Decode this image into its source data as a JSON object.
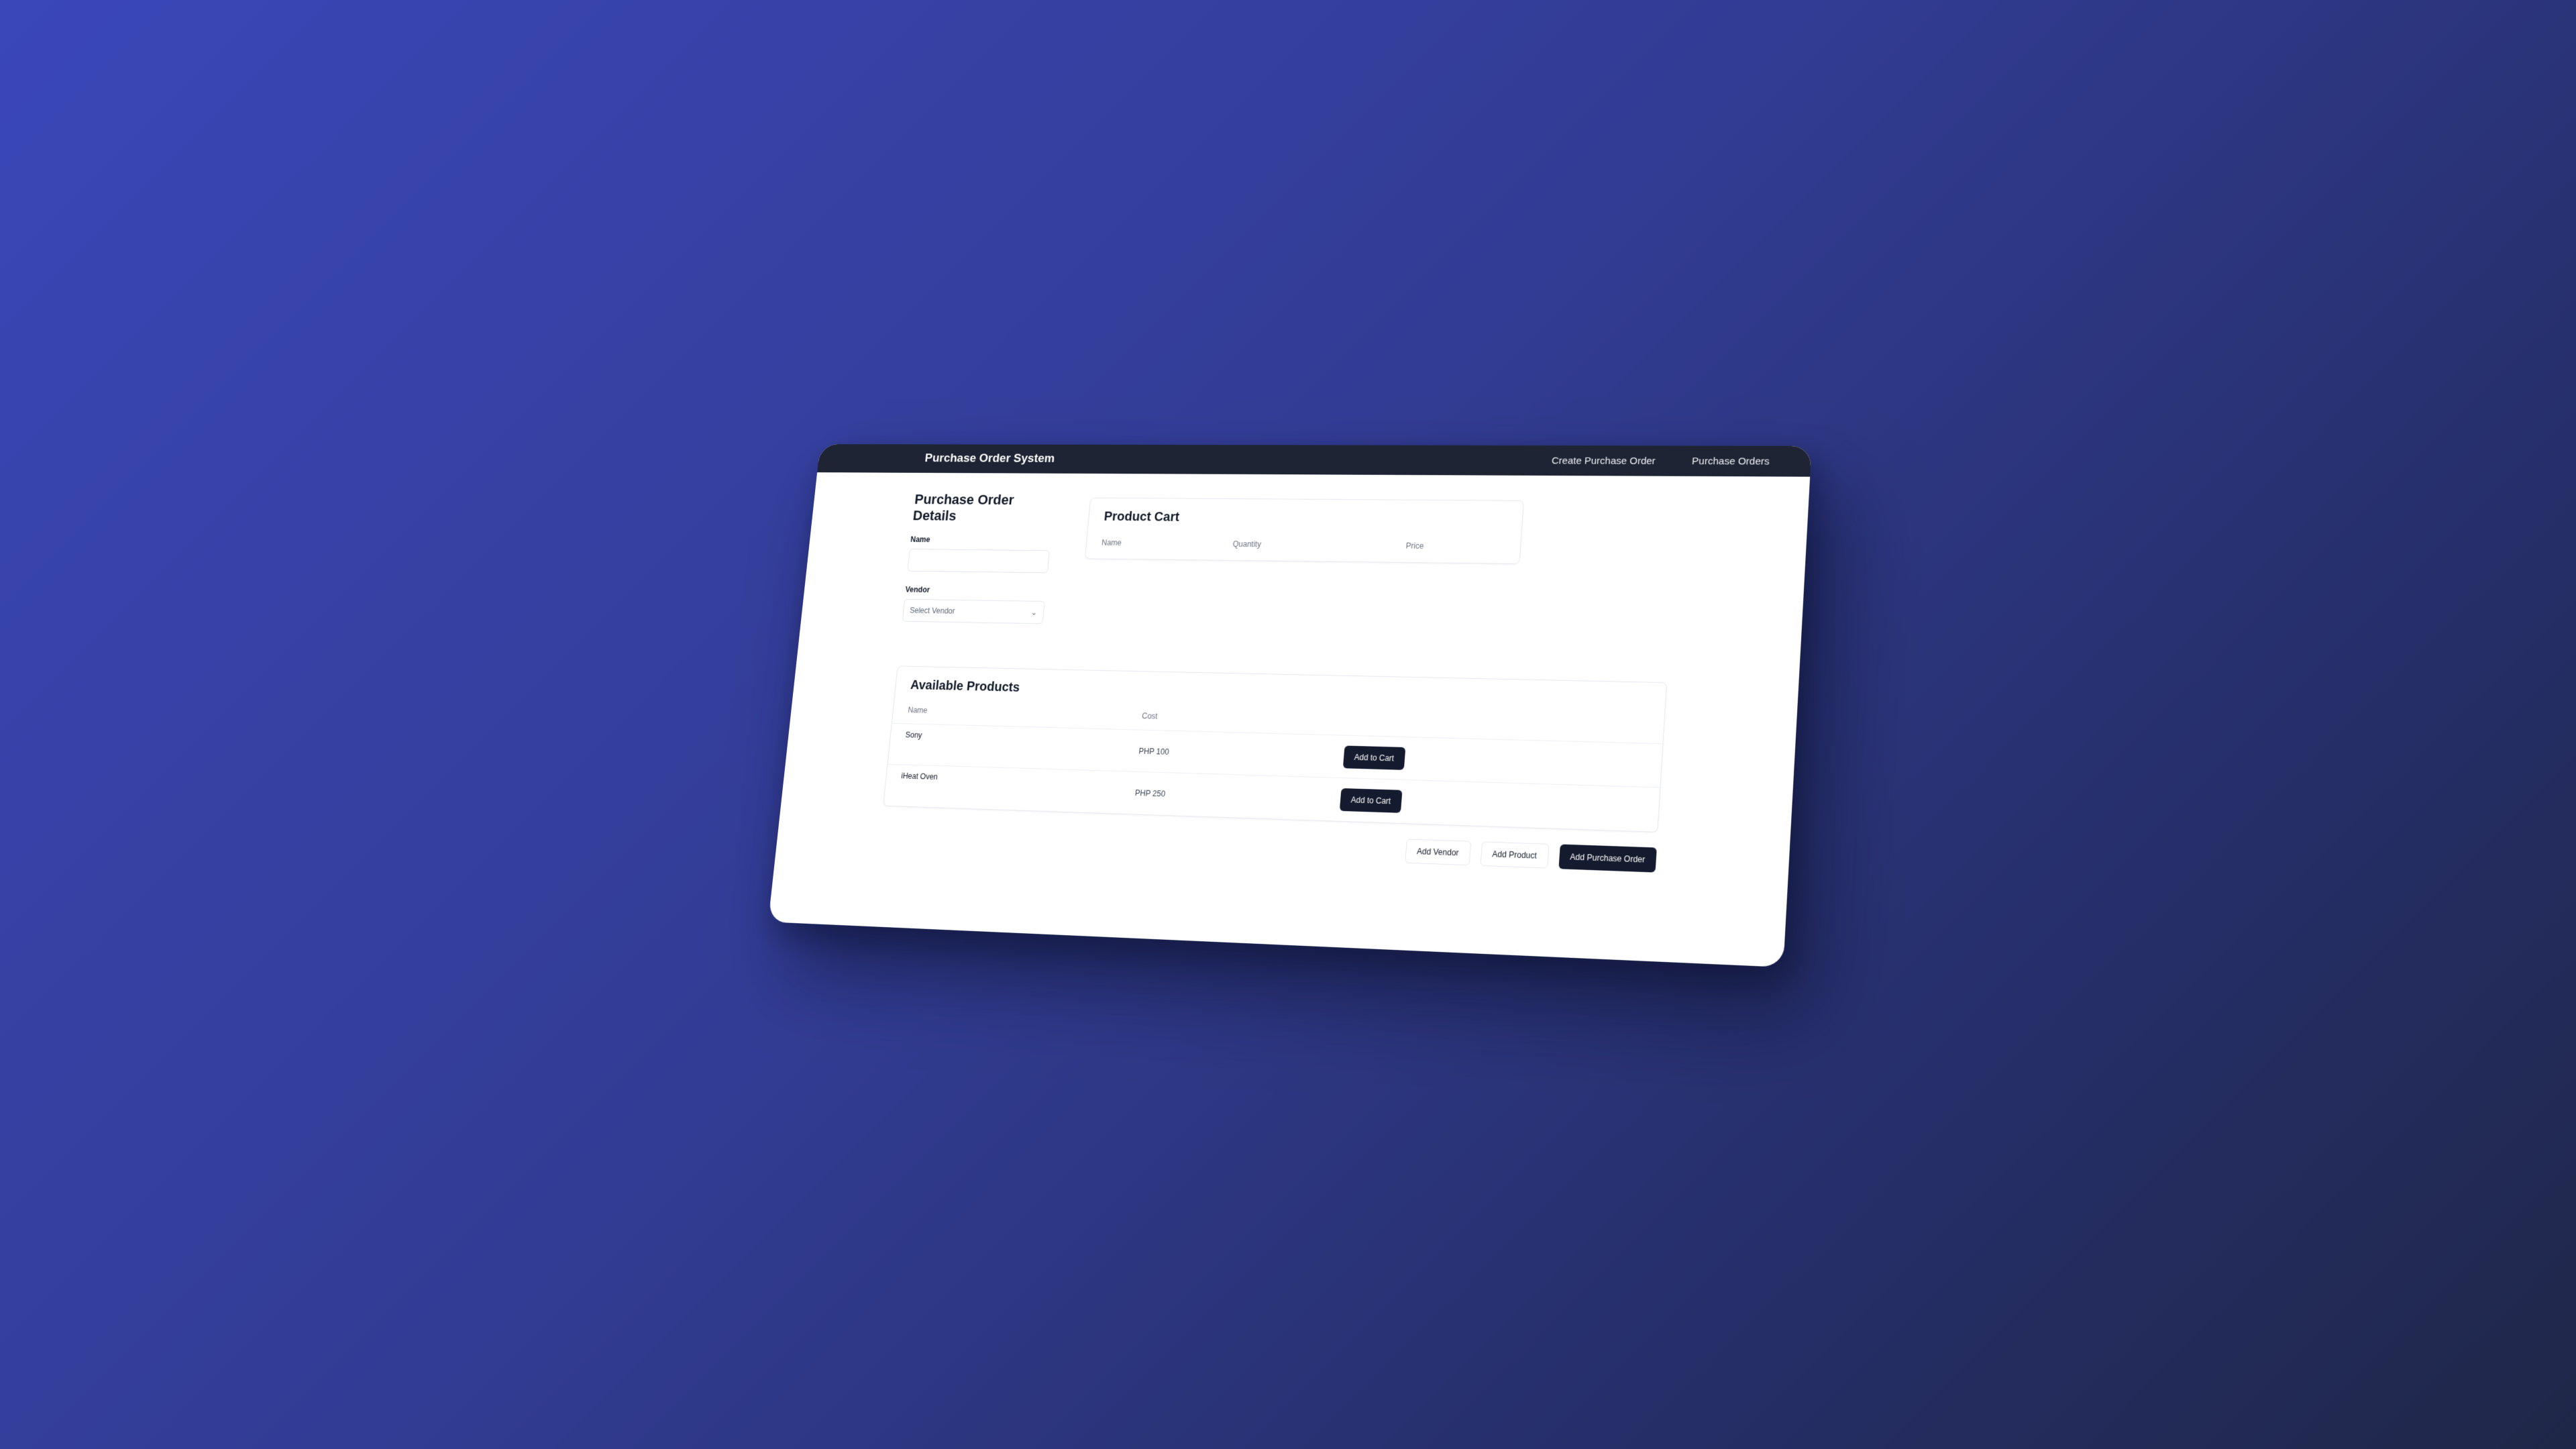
{
  "navbar": {
    "brand": "Purchase Order System",
    "links": [
      "Create Purchase Order",
      "Purchase Orders"
    ]
  },
  "details": {
    "title": "Purchase Order Details",
    "name_label": "Name",
    "name_value": "",
    "vendor_label": "Vendor",
    "vendor_selected": "Select Vendor"
  },
  "cart": {
    "title": "Product Cart",
    "columns": [
      "Name",
      "Quantity",
      "Price"
    ]
  },
  "products": {
    "title": "Available Products",
    "columns": [
      "Name",
      "Cost"
    ],
    "rows": [
      {
        "name": "Sony",
        "cost": "PHP 100",
        "action": "Add to Cart"
      },
      {
        "name": "iHeat Oven",
        "cost": "PHP 250",
        "action": "Add to Cart"
      }
    ]
  },
  "actions": {
    "add_vendor": "Add Vendor",
    "add_product": "Add Product",
    "add_purchase_order": "Add Purchase Order"
  },
  "colors": {
    "navbar": "#1e2433",
    "primary_button": "#151b2e",
    "background_start": "#3a47b8",
    "background_end": "#1f2748"
  }
}
